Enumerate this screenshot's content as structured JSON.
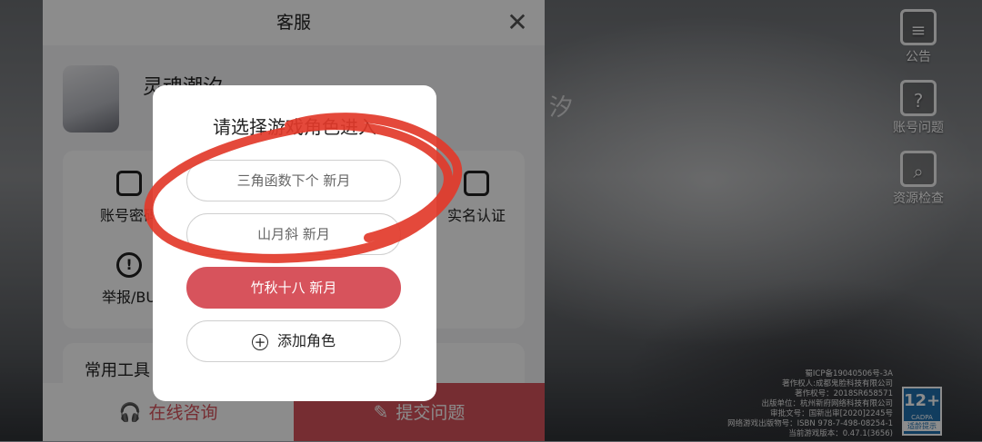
{
  "background": {
    "title_fragment": "汐",
    "side_buttons": [
      {
        "icon": "scroll-icon",
        "label": "公告"
      },
      {
        "icon": "document-question-icon",
        "label": "账号问题"
      },
      {
        "icon": "magnifier-document-icon",
        "label": "资源检查"
      }
    ],
    "legal_lines": [
      "蜀ICP备19040506号-3A",
      "著作权人:成都鬼脸科技有限公司",
      "著作权号：2018SR658571",
      "出版单位：杭州新府网络科技有限公司",
      "审批文号：国新出审[2020]2245号",
      "网络游戏出版物号：ISBN 978-7-498-08254-1",
      "当前游戏版本：0.47.1(3656)"
    ],
    "age_badge": {
      "number": "12+",
      "org": "CADPA",
      "text": "适龄提示"
    }
  },
  "panel": {
    "title": "客服",
    "close_symbol": "✕",
    "game_name": "灵魂潮汐",
    "grid": [
      {
        "icon": "lock-icon",
        "glyph": "🔒",
        "label": "账号密码"
      },
      {
        "icon": "id-card-icon",
        "glyph": "▯",
        "label": "实名认证"
      },
      {
        "icon": "alert-icon",
        "glyph": "!",
        "label": "举报/BU"
      }
    ],
    "tools_label": "常用工具",
    "footer": {
      "left_label": "在线咨询",
      "left_icon": "🎧",
      "right_label": "提交问题",
      "right_icon": "✎"
    }
  },
  "dialog": {
    "title": "请选择游戏角色进入",
    "roles": [
      "三角函数下个 新月",
      "山月斜 新月",
      "竹秋十八 新月"
    ],
    "add_role_label": "添加角色",
    "add_symbol": "+"
  },
  "colors": {
    "accent": "#d7535c",
    "annotation": "#e23a2a"
  }
}
